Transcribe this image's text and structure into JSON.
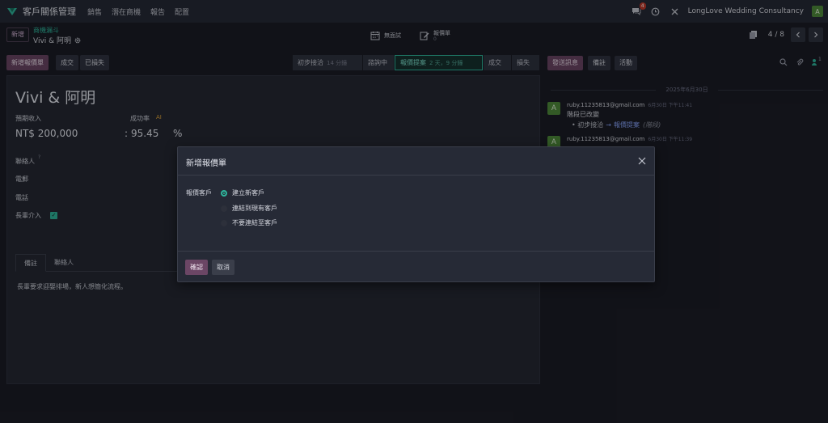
{
  "navbar": {
    "app_name": "客戶關係管理",
    "menu": [
      "銷售",
      "潛在商機",
      "報告",
      "配置"
    ],
    "message_count": "4",
    "company": "LongLove Wedding Consultancy",
    "user_initial": "A"
  },
  "control": {
    "new_label": "新增",
    "breadcrumb_parent": "商機漏斗",
    "breadcrumb_current": "Vivi & 阿明",
    "smart_meeting_label": "無面試",
    "smart_quote_label": "報價單",
    "smart_quote_count": "0",
    "pager_value": "4 / 8"
  },
  "statusbar": {
    "new_quote": "新增報價單",
    "won": "成交",
    "lost": "已損失",
    "stages": [
      {
        "name": "初步接洽",
        "duration": "14 分鐘"
      },
      {
        "name": "諮詢中",
        "duration": ""
      },
      {
        "name": "報價提案",
        "duration": "2 天，9 分鐘"
      },
      {
        "name": "成交",
        "duration": ""
      },
      {
        "name": "損失",
        "duration": ""
      }
    ]
  },
  "form": {
    "title": "Vivi & 阿明",
    "expected_revenue_label": "預期收入",
    "expected_revenue": "NT$ 200,000",
    "probability_label": "成功率",
    "probability_ai": "AI",
    "probability_colon": ":",
    "probability": "95.45",
    "percent": "%",
    "contact_label": "聯絡人",
    "contact_help": "?",
    "email_label": "電郵",
    "phone_label": "電話",
    "elder_label": "長輩介入",
    "elder_check": "✓",
    "tabs": [
      "備註",
      "聯絡人"
    ],
    "note": "長輩要求迎娶排場，新人想簡化流程。"
  },
  "chatter": {
    "send_message": "發送訊息",
    "log_note": "備註",
    "activity": "活動",
    "follower_count": "1",
    "date_divider": "2025年6月30日",
    "messages": [
      {
        "avatar": "A",
        "author": "ruby.11235813@gmail.com",
        "time": "6月30日 下午11:41",
        "body": "階段已改變",
        "track_old": "初步接洽",
        "track_arrow": "→",
        "track_new": "報價提案",
        "track_field": "(階段)"
      },
      {
        "avatar": "A",
        "author": "ruby.11235813@gmail.com",
        "time": "6月30日 下午11:39"
      }
    ]
  },
  "dialog": {
    "title": "新增報價單",
    "customer_label": "報價客戶",
    "options": [
      "建立新客戶",
      "連結到現有客戶",
      "不要連結至客戶"
    ],
    "selected_index": 0,
    "confirm": "確認",
    "cancel": "取消"
  },
  "colors": {
    "accent": "#2fb59c",
    "primary": "#6b4665",
    "background": "#1b1d26"
  }
}
